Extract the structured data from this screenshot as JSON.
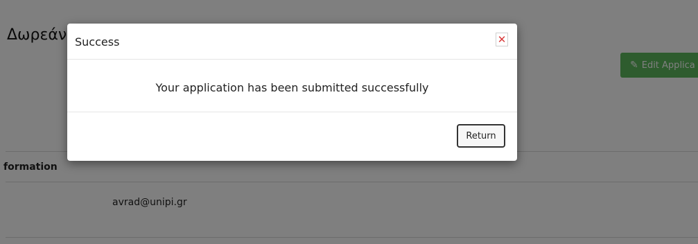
{
  "page": {
    "title": "Δωρεάν",
    "edit_button_label": "Edit Applica",
    "section_heading": "formation",
    "email": "avrad@unipi.gr"
  },
  "modal": {
    "title": "Success",
    "close_icon": "close-icon",
    "message": "Your application has been submitted successfully",
    "return_label": "Return"
  },
  "colors": {
    "edit_button": "#5cb85c",
    "close_x": "#d93a3a",
    "backdrop": "rgba(0,0,0,0.5)"
  }
}
